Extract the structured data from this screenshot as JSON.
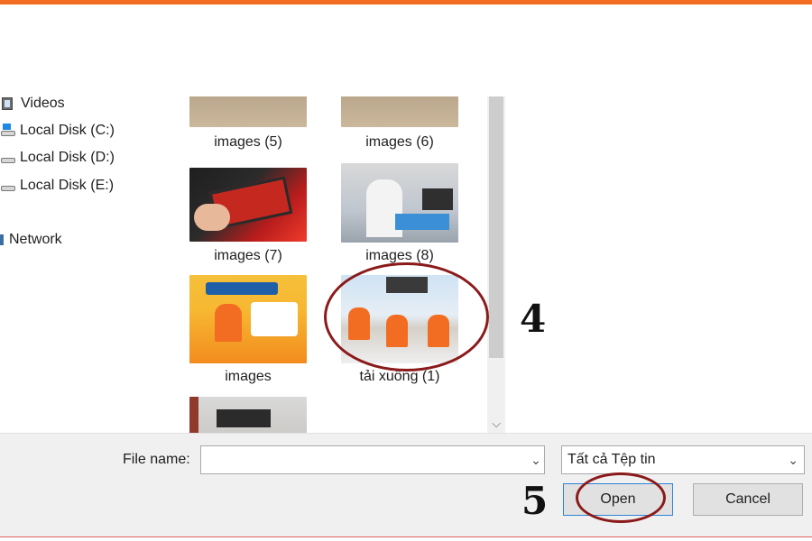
{
  "nav": {
    "items": [
      {
        "label": "Videos",
        "icon": "video-folder-icon"
      },
      {
        "label": "Local Disk (C:)",
        "icon": "system-disk-icon"
      },
      {
        "label": "Local Disk (D:)",
        "icon": "disk-drive-icon"
      },
      {
        "label": "Local Disk (E:)",
        "icon": "disk-drive-icon"
      },
      {
        "label": "Network",
        "icon": "network-icon"
      }
    ]
  },
  "files": [
    {
      "name": "images (5)"
    },
    {
      "name": "images (6)"
    },
    {
      "name": "images (7)"
    },
    {
      "name": "images (8)"
    },
    {
      "name": "images"
    },
    {
      "name": "tải xuống (1)",
      "highlighted": true
    }
  ],
  "annotations": {
    "step4": "4",
    "step5": "5",
    "highlight_color": "#8b1a1a"
  },
  "footer": {
    "file_name_label": "File name:",
    "file_name_value": "",
    "file_type_selected": "Tất cả Tệp tin",
    "open_label": "Open",
    "cancel_label": "Cancel"
  },
  "colors": {
    "accent_bar": "#f26d21",
    "open_border": "#2f84d6"
  }
}
